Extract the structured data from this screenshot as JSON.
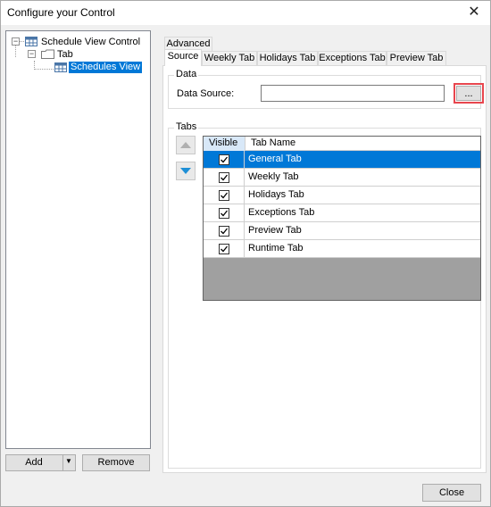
{
  "window": {
    "title": "Configure your Control"
  },
  "tree": {
    "root": {
      "label": "Schedule View Control"
    },
    "child": {
      "label": "Tab"
    },
    "leaf": {
      "label": "Schedules View"
    }
  },
  "left_buttons": {
    "add_label": "Add",
    "remove_label": "Remove"
  },
  "tabs_row1": [
    {
      "label": "Advanced"
    }
  ],
  "tabs_row2": [
    {
      "label": "Source"
    },
    {
      "label": "Weekly Tab"
    },
    {
      "label": "Holidays Tab"
    },
    {
      "label": "Exceptions Tab"
    },
    {
      "label": "Preview Tab"
    }
  ],
  "active_tab": "Source",
  "data_group": {
    "title": "Data",
    "source_label": "Data Source:",
    "source_value": "",
    "browse_label": "..."
  },
  "tabs_group": {
    "title": "Tabs",
    "columns": [
      "Visible",
      "Tab Name"
    ],
    "rows": [
      {
        "visible": true,
        "name": "General Tab",
        "selected": true
      },
      {
        "visible": true,
        "name": "Weekly Tab",
        "selected": false
      },
      {
        "visible": true,
        "name": "Holidays Tab",
        "selected": false
      },
      {
        "visible": true,
        "name": "Exceptions Tab",
        "selected": false
      },
      {
        "visible": true,
        "name": "Preview Tab",
        "selected": false
      },
      {
        "visible": true,
        "name": "Runtime Tab",
        "selected": false
      }
    ]
  },
  "footer": {
    "close_label": "Close"
  },
  "colors": {
    "selection": "#0078d7",
    "highlight_border": "#e8464e",
    "arrow_down": "#1e8fd6"
  }
}
